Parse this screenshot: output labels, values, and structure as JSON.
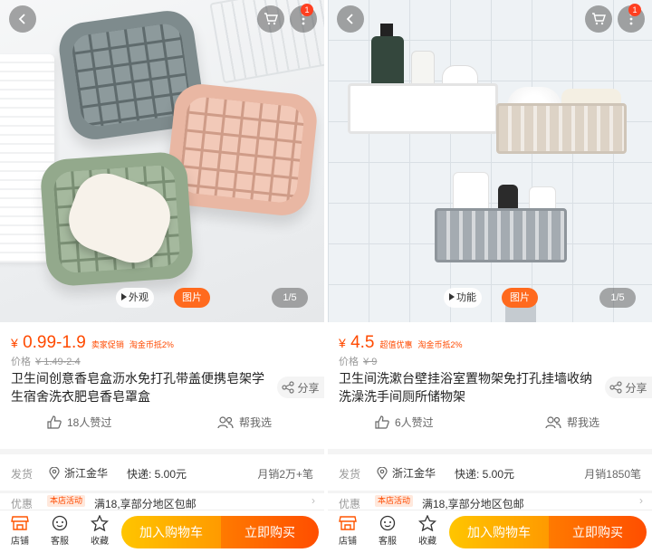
{
  "colors": {
    "accent": "#ff4a00",
    "cart_button": "#ffb300",
    "buy_button": "#ff5500",
    "badge": "#ff3f20"
  },
  "icons": [
    "back-icon",
    "cart-icon",
    "more-icon",
    "share-icon",
    "like-icon",
    "help-icon",
    "location-icon",
    "shop-icon",
    "customer-service-icon",
    "star-icon",
    "chevron-right-icon",
    "play-icon"
  ],
  "left": {
    "cart_badge": "1",
    "pill_view": "外观",
    "pill_pic": "图片",
    "page_indicator": "1/5",
    "price_currency": "¥",
    "price": "0.99-1.9",
    "tag1": "卖家促销",
    "tag2": "淘金币抵2%",
    "orig_label": "价格",
    "orig_value": "¥ 1.49-2.4",
    "title": "卫生间创意香皂盒沥水免打孔带盖便携皂架学生宿舍洗衣肥皂香皂罩盒",
    "share": "分享",
    "likes": "18人赞过",
    "help": "帮我选",
    "ship_label": "发货",
    "location": "浙江金华",
    "fee": "快递: 5.00元",
    "sales": "月销2万+笔",
    "promo_label": "优惠",
    "promo_badge": "本店活动",
    "promo_text": "满18,享部分地区包邮",
    "nav_shop": "店铺",
    "nav_cs": "客服",
    "nav_fav": "收藏",
    "add_cart": "加入购物车",
    "buy_now": "立即购买"
  },
  "right": {
    "cart_badge": "1",
    "pill_view": "功能",
    "pill_pic": "图片",
    "page_indicator": "1/5",
    "price_currency": "¥",
    "price": "4.5",
    "tag1": "超值优惠",
    "tag2": "淘金币抵2%",
    "orig_label": "价格",
    "orig_value": "¥ 9",
    "title": "卫生间洗漱台壁挂浴室置物架免打孔挂墙收纳洗澡洗手间厕所储物架",
    "share": "分享",
    "likes": "6人赞过",
    "help": "帮我选",
    "ship_label": "发货",
    "location": "浙江金华",
    "fee": "快递: 5.00元",
    "sales": "月销1850笔",
    "promo_label": "优惠",
    "promo_badge": "本店活动",
    "promo_text": "满18,享部分地区包邮",
    "nav_shop": "店铺",
    "nav_cs": "客服",
    "nav_fav": "收藏",
    "add_cart": "加入购物车",
    "buy_now": "立即购买"
  }
}
